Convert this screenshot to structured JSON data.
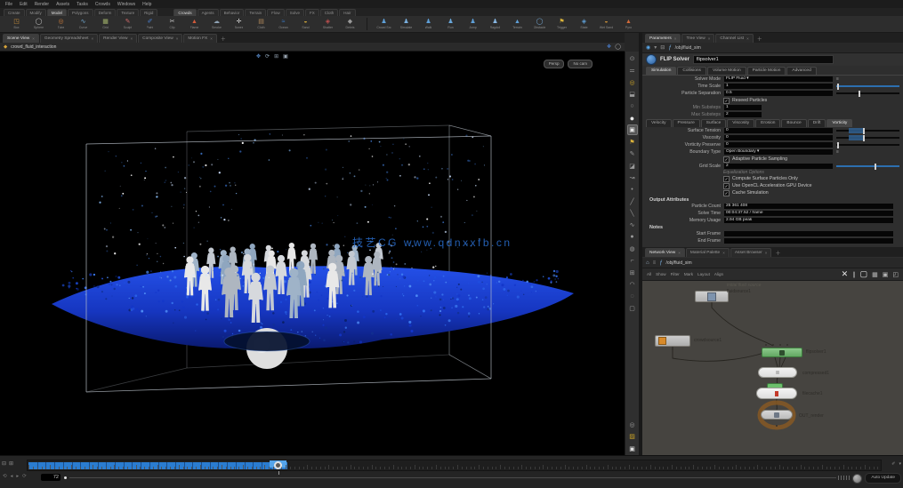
{
  "menubar": {
    "items": [
      "File",
      "Edit",
      "Render",
      "Assets",
      "Tasks",
      "Crowds",
      "Windows",
      "Help"
    ]
  },
  "shelf": {
    "left_tabs": [
      "Create",
      "Modify",
      "Model",
      "Polygons",
      "Deform",
      "Texture",
      "Rigid"
    ],
    "left_active": 2,
    "left_tools": [
      {
        "name": "box-tool",
        "glyph": "◳",
        "color": "#c98f3a",
        "label": "Box"
      },
      {
        "name": "sphere-tool",
        "glyph": "◯",
        "color": "#cfcfcf",
        "label": "Sphere"
      },
      {
        "name": "tube-tool",
        "glyph": "◎",
        "color": "#c9793a",
        "label": "Tube"
      },
      {
        "name": "curve-tool",
        "glyph": "∿",
        "color": "#6fa8d0",
        "label": "Curve"
      },
      {
        "name": "grid-tool",
        "glyph": "▦",
        "color": "#9fb06a",
        "label": "Grid"
      },
      {
        "name": "sculpt-tool",
        "glyph": "✎",
        "color": "#d06a6a",
        "label": "Sculpt"
      },
      {
        "name": "paint-tool",
        "glyph": "✐",
        "color": "#4a7fd0",
        "label": "Paint"
      },
      {
        "name": "clip-tool",
        "glyph": "✂",
        "color": "#c9c9c9",
        "label": "Clip"
      },
      {
        "name": "flame-tool",
        "glyph": "▲",
        "color": "#d05a3a",
        "label": "Flame"
      },
      {
        "name": "smoke-tool",
        "glyph": "☁",
        "color": "#8fa3b5",
        "label": "Smoke"
      },
      {
        "name": "bones-tool",
        "glyph": "✛",
        "color": "#d8d8d8",
        "label": "Bones"
      },
      {
        "name": "cloth-tool",
        "glyph": "▤",
        "color": "#b08a5a",
        "label": "Cloth"
      },
      {
        "name": "ocean-tool",
        "glyph": "≈",
        "color": "#3a7fd0",
        "label": "Ocean"
      },
      {
        "name": "sand-tool",
        "glyph": "◒",
        "color": "#c9a23a",
        "label": "Sand"
      },
      {
        "name": "shatter-tool",
        "glyph": "◈",
        "color": "#c05050",
        "label": "Shatter"
      },
      {
        "name": "debris-tool",
        "glyph": "◆",
        "color": "#9a9a9a",
        "label": "Debris"
      }
    ],
    "right_tabs": [
      "Crowds",
      "Agents",
      "Behavior",
      "Terrain",
      "Flow",
      "Solve",
      "FX",
      "Cloth",
      "Hair"
    ],
    "right_active": 0,
    "right_tools": [
      {
        "name": "crowd-source-tool",
        "glyph": "♟",
        "color": "#5fa0d8",
        "label": "Crowd Src"
      },
      {
        "name": "simulate-tool",
        "glyph": "♟",
        "color": "#7ab0e0",
        "label": "Simulate"
      },
      {
        "name": "walk-tool",
        "glyph": "♟",
        "color": "#5fa0d8",
        "label": "Walk"
      },
      {
        "name": "run-tool",
        "glyph": "♟",
        "color": "#6aa8dc",
        "label": "Run"
      },
      {
        "name": "jump-tool",
        "glyph": "♟",
        "color": "#5fa0d8",
        "label": "Jump"
      },
      {
        "name": "ragdoll-tool",
        "glyph": "♟",
        "color": "#88b8e4",
        "label": "Ragdoll"
      },
      {
        "name": "terrain-tool",
        "glyph": "▲",
        "color": "#5fa0d8",
        "label": "Terrain"
      },
      {
        "name": "obstacle-tool",
        "glyph": "◯",
        "color": "#7ab0e0",
        "label": "Obstacle"
      },
      {
        "name": "trigger-tool",
        "glyph": "⚑",
        "color": "#d8b23a",
        "label": "Trigger"
      },
      {
        "name": "state-tool",
        "glyph": "◈",
        "color": "#5fa0d8",
        "label": "State"
      },
      {
        "name": "wetsand-tool",
        "glyph": "◒",
        "color": "#c98f3a",
        "label": "Wet Sand"
      },
      {
        "name": "pyro-tool",
        "glyph": "▲",
        "color": "#d06a3a",
        "label": "Pyro"
      }
    ]
  },
  "pane_tabs": {
    "viewport": {
      "tabs": [
        "Scene View",
        "Geometry Spreadsheet",
        "Render View",
        "Composite View",
        "Motion FX"
      ],
      "active": 0
    },
    "params": {
      "tabs": [
        "Parameters",
        "Tree View",
        "Channel List"
      ],
      "active": 0
    },
    "network": {
      "tabs": [
        "Network View",
        "Material Palette",
        "Asset Browser"
      ],
      "active": 0
    }
  },
  "viewport": {
    "path_text": "crowd_fluid_interaction",
    "pills": [
      "Persp",
      "No cam"
    ],
    "watermark": "技艺CG www.qdnxxfb.cn",
    "minitools": [
      {
        "name": "handles-icon",
        "glyph": "✥",
        "color": "#5b8fd0"
      },
      {
        "name": "refresh-icon",
        "glyph": "⟳",
        "color": "#8fa3b5"
      },
      {
        "name": "grid-icon",
        "glyph": "⊞",
        "color": "#8a97a5"
      },
      {
        "name": "box-icon",
        "glyph": "▣",
        "color": "#9aa5b1"
      }
    ],
    "side_toolbar": [
      {
        "name": "select-tool-icon",
        "glyph": "⊙"
      },
      {
        "name": "translate-tool-icon",
        "glyph": "⚌"
      },
      {
        "name": "rotate-tool-icon",
        "glyph": "◎",
        "color": "#c9a227"
      },
      {
        "name": "scale-tool-icon",
        "glyph": "⬓"
      },
      {
        "name": "view-tool-icon",
        "glyph": "○"
      },
      {
        "name": "shade-mode-icon",
        "glyph": "●",
        "big": true
      },
      {
        "name": "display-options-icon",
        "glyph": "▣",
        "active": true
      },
      {
        "name": "snap-icon",
        "glyph": "⚑",
        "color": "#d9b13b"
      },
      {
        "name": "draw-icon",
        "glyph": "✎"
      },
      {
        "name": "material-icon",
        "glyph": "◪"
      },
      {
        "name": "path-icon",
        "glyph": "↝"
      },
      {
        "name": "point-icon",
        "glyph": "•"
      },
      {
        "name": "measure-icon",
        "glyph": "╱"
      },
      {
        "name": "ruler-icon",
        "glyph": "╲"
      },
      {
        "name": "wave-icon",
        "glyph": "∿"
      },
      {
        "name": "sphere-icon",
        "glyph": "●"
      },
      {
        "name": "light-icon",
        "glyph": "◍"
      },
      {
        "name": "clip-plane-icon",
        "glyph": "⌐"
      },
      {
        "name": "grid-toggle-icon",
        "glyph": "⊞"
      },
      {
        "name": "camera-icon",
        "glyph": "◠"
      },
      {
        "name": "info-icon",
        "glyph": "◌"
      },
      {
        "name": "mask-icon",
        "glyph": "▢"
      }
    ],
    "side_toolbar_bottom": [
      {
        "name": "ring-icon",
        "glyph": "◎"
      },
      {
        "name": "flag-icon",
        "glyph": "▨",
        "color": "#c9a227"
      },
      {
        "name": "solo-icon",
        "glyph": "▣",
        "color": "#e0e0e0"
      }
    ]
  },
  "params": {
    "header": {
      "path": "/obj/fluid_sim"
    },
    "node": {
      "type": "FLIP Solver",
      "name": "flipsolver1"
    },
    "tabs1": [
      "Simulation",
      "Collisions",
      "Volume Motion",
      "Particle Motion",
      "Advanced"
    ],
    "tabs1_active": 0,
    "rows": [
      {
        "k": "menu",
        "label": "Solver Mode",
        "value": "FLIP Fluid"
      },
      {
        "k": "slider",
        "label": "Time Scale",
        "value": "1",
        "pos": 0.02,
        "blue": true
      },
      {
        "k": "slider",
        "label": "Particle Separation",
        "value": "0.5",
        "pos": 0.35
      },
      {
        "k": "check",
        "label": "Reseed Particles",
        "checked": true
      },
      {
        "k": "sub",
        "label": "Min Substeps",
        "value": "1"
      },
      {
        "k": "sub",
        "label": "Max Substeps",
        "value": "2"
      },
      {
        "k": "tabs",
        "items": [
          "Velocity",
          "Pressure",
          "Surface",
          "Viscosity",
          "Erosion",
          "Bounce",
          "Drift",
          "Vorticity"
        ],
        "active": 7
      },
      {
        "k": "slider",
        "label": "Surface Tension",
        "value": "0",
        "pos": 0.42,
        "seg": true
      },
      {
        "k": "slider",
        "label": "Viscosity",
        "value": "0",
        "pos": 0.42,
        "seg": true
      },
      {
        "k": "slider",
        "label": "Vorticity Preserve",
        "value": "0",
        "pos": 0.02
      },
      {
        "k": "menu",
        "label": "Boundary Type",
        "value": "Open Boundary"
      },
      {
        "k": "check",
        "label": "Adaptive Particle Sampling",
        "checked": true
      },
      {
        "k": "slider",
        "label": "Grid Scale",
        "value": "2",
        "pos": 0.6,
        "blue": true
      },
      {
        "k": "gray",
        "label": "Equalization Options"
      },
      {
        "k": "check",
        "label": "Compute Surface Particles Only",
        "checked": true
      },
      {
        "k": "check",
        "label": "Use OpenCL Acceleration   GPU Device",
        "checked": true
      },
      {
        "k": "check",
        "label": "Cache Simulation",
        "checked": true
      },
      {
        "k": "section",
        "label": "Output Attributes"
      },
      {
        "k": "field",
        "label": "Particle Count",
        "value": "25 361 408"
      },
      {
        "k": "field",
        "label": "Solve Time",
        "value": "00:04:37.52 / frame"
      },
      {
        "k": "field",
        "label": "Memory Usage",
        "value": "2.94 GB peak"
      },
      {
        "k": "section",
        "label": "Notes"
      },
      {
        "k": "field",
        "label": "Start Frame",
        "value": ""
      },
      {
        "k": "field",
        "label": "End Frame",
        "value": ""
      }
    ]
  },
  "network": {
    "path": "/obj/fluid_sim",
    "toolbar": [
      "All",
      "Show",
      "Filter",
      "Mark",
      "Layout",
      "Align"
    ],
    "icons": [
      {
        "name": "close-icon",
        "glyph": "✕",
        "big": true
      },
      {
        "name": "split-icon",
        "glyph": "∥"
      },
      {
        "name": "panel-icon",
        "glyph": "▢",
        "big": true
      },
      {
        "name": "frame-all-icon",
        "glyph": "▦"
      },
      {
        "name": "frame-sel-icon",
        "glyph": "▣"
      },
      {
        "name": "corner-icon",
        "glyph": "◰"
      }
    ],
    "nodes": {
      "source": {
        "name": "fluidsource1",
        "comment": "initial fluid source"
      },
      "crowd": {
        "name": "crowdsource1"
      },
      "solver": {
        "name": "flipsolver1"
      },
      "compress": {
        "name": "compressed1"
      },
      "cache": {
        "name": "filecache1"
      },
      "out": {
        "name": "OUT_render"
      }
    }
  },
  "playbar": {
    "frame": "72",
    "auto_update": "Auto Update",
    "ruler_icons": [
      {
        "name": "key-icon",
        "glyph": "⊟"
      },
      {
        "name": "range-icon",
        "glyph": "⊞"
      }
    ],
    "ruler_right_icons": [
      {
        "name": "edit-icon",
        "glyph": "✐"
      },
      {
        "name": "options-icon",
        "glyph": "▾"
      }
    ],
    "ctrl_icons": [
      {
        "name": "loop-icon",
        "glyph": "⟲"
      },
      {
        "name": "step-back-icon",
        "glyph": "◂"
      },
      {
        "name": "play-icon",
        "glyph": "▸"
      },
      {
        "name": "step-forward-icon",
        "glyph": "⟳"
      }
    ]
  }
}
